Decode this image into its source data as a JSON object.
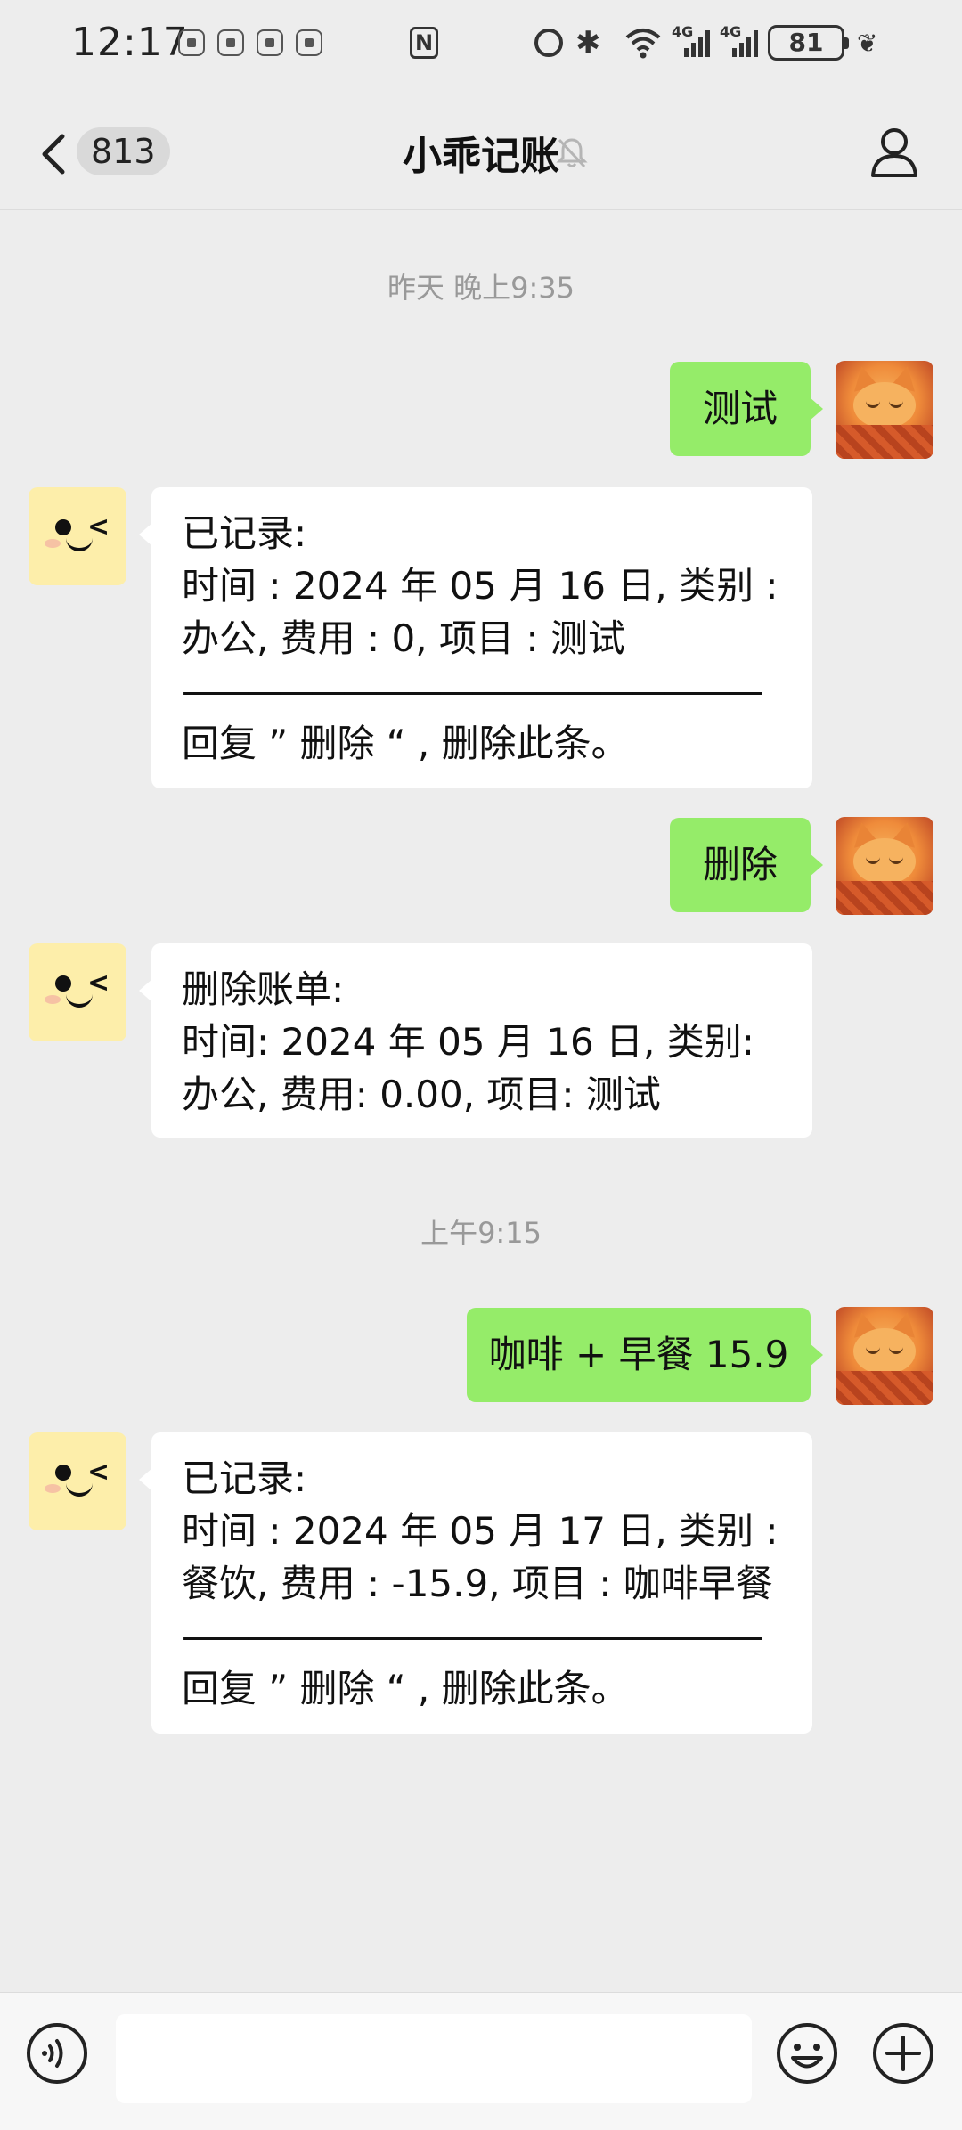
{
  "status_bar": {
    "time": "12:17",
    "nfc": "N",
    "signal1": "4G",
    "signal2": "4G",
    "battery": "81"
  },
  "header": {
    "back_count": "813",
    "title": "小乖记账"
  },
  "messages": {
    "ts1": "昨天 晚上9:35",
    "m1_out": "测试",
    "m2_in": [
      "已记录:",
      "时间 : 2024 年 05 月 16 日, 类别 :",
      "办公, 费用 : 0, 项目 : 测试",
      "——————————————————",
      "回复 ” 删除 “ , 删除此条。"
    ],
    "m3_out": "删除",
    "m4_in": [
      "删除账单:",
      "时间:  2024 年 05 月 16 日,  类别:",
      "办公,  费用:  0.00,  项目:  测试"
    ],
    "ts2": "上午9:15",
    "m5_out": "咖啡 + 早餐 15.9",
    "m6_in": [
      "已记录:",
      "时间 : 2024 年 05 月 17 日, 类别 :",
      "餐饮, 费用 : -15.9, 项目 : 咖啡早餐",
      "——————————————————",
      "回复 ” 删除 “ , 删除此条。"
    ]
  },
  "input": {
    "value": ""
  },
  "colors": {
    "background": "#ededed",
    "outgoing_bubble": "#95ec69",
    "incoming_bubble": "#ffffff"
  }
}
